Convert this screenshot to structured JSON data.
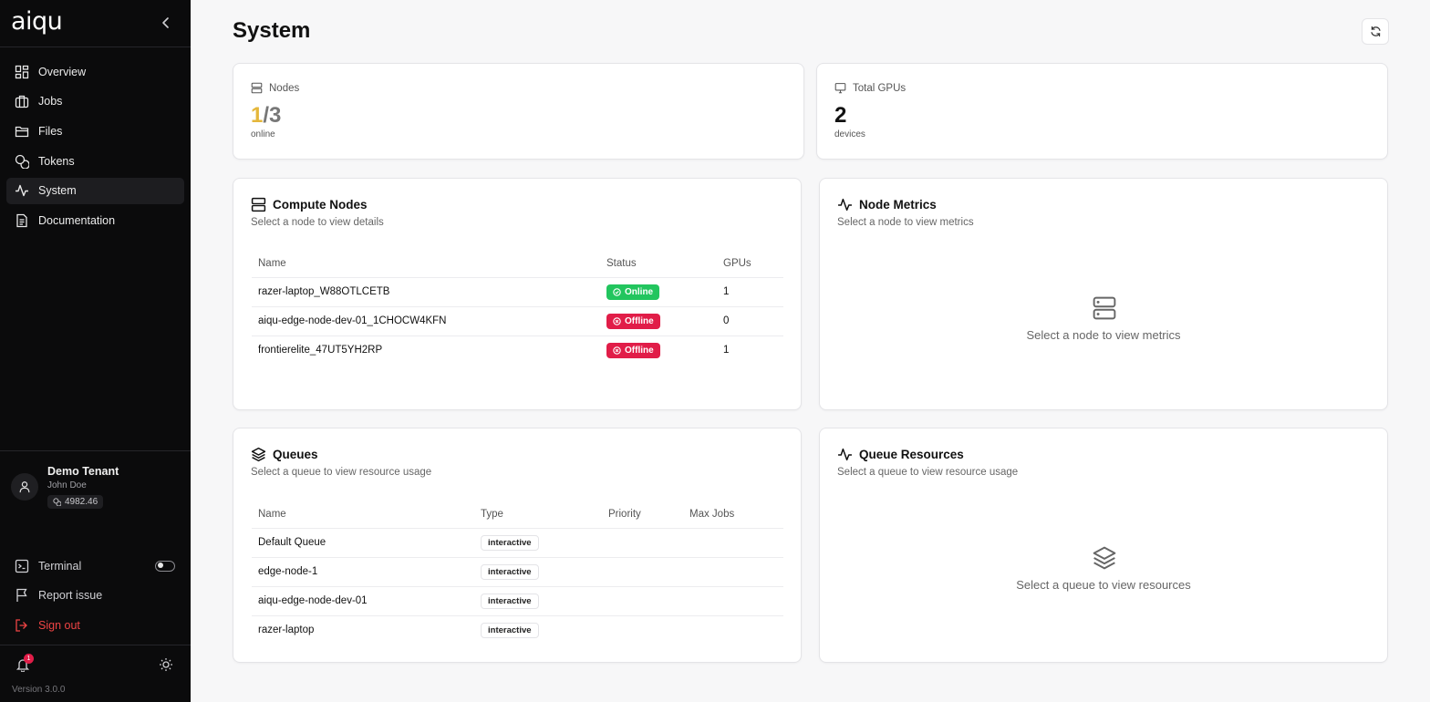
{
  "app": {
    "logo": "aiqu",
    "version": "Version 3.0.0"
  },
  "sidebar": {
    "items": [
      {
        "label": "Overview",
        "icon": "grid-icon"
      },
      {
        "label": "Jobs",
        "icon": "briefcase-icon"
      },
      {
        "label": "Files",
        "icon": "folder-icon"
      },
      {
        "label": "Tokens",
        "icon": "coins-icon"
      },
      {
        "label": "System",
        "icon": "activity-icon",
        "active": true
      },
      {
        "label": "Documentation",
        "icon": "document-icon"
      }
    ],
    "user": {
      "tenant": "Demo Tenant",
      "name": "John Doe",
      "credits": "4982.46"
    },
    "bottom": {
      "terminal": "Terminal",
      "report": "Report issue",
      "signout": "Sign out"
    },
    "notifications_count": "1"
  },
  "page": {
    "title": "System"
  },
  "stats": {
    "nodes": {
      "label": "Nodes",
      "online": "1",
      "total": "/3",
      "sub": "online"
    },
    "gpus": {
      "label": "Total GPUs",
      "value": "2",
      "sub": "devices"
    }
  },
  "compute_nodes": {
    "title": "Compute Nodes",
    "subtitle": "Select a node to view details",
    "headers": [
      "Name",
      "Status",
      "GPUs"
    ],
    "rows": [
      {
        "name": "razer-laptop_W88OTLCETB",
        "status": "Online",
        "gpus": "1"
      },
      {
        "name": "aiqu-edge-node-dev-01_1CHOCW4KFN",
        "status": "Offline",
        "gpus": "0"
      },
      {
        "name": "frontierelite_47UT5YH2RP",
        "status": "Offline",
        "gpus": "1"
      }
    ]
  },
  "node_metrics": {
    "title": "Node Metrics",
    "subtitle": "Select a node to view metrics",
    "empty": "Select a node to view metrics"
  },
  "queues": {
    "title": "Queues",
    "subtitle": "Select a queue to view resource usage",
    "headers": [
      "Name",
      "Type",
      "Priority",
      "Max Jobs"
    ],
    "rows": [
      {
        "name": "Default Queue",
        "type": "interactive"
      },
      {
        "name": "edge-node-1",
        "type": "interactive"
      },
      {
        "name": "aiqu-edge-node-dev-01",
        "type": "interactive"
      },
      {
        "name": "razer-laptop",
        "type": "interactive"
      }
    ]
  },
  "queue_resources": {
    "title": "Queue Resources",
    "subtitle": "Select a queue to view resource usage",
    "empty": "Select a queue to view resources"
  },
  "colors": {
    "online": "#22c55e",
    "offline": "#e11d48",
    "highlight": "#e5b73b",
    "sidebar_bg": "#0b0b0c"
  }
}
